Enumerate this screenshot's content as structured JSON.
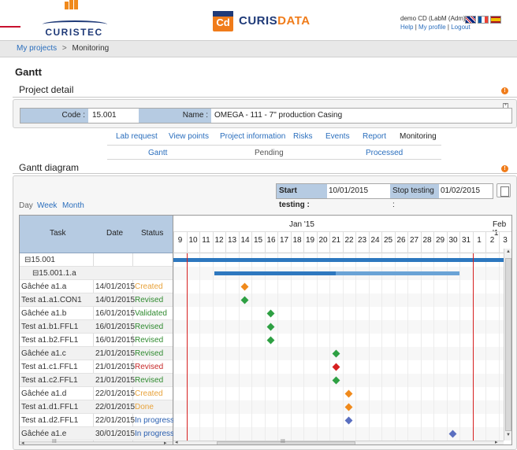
{
  "header": {
    "logo_left": "CURISTEC",
    "logo_center_mark": "Cd",
    "brand_a": "CURIS",
    "brand_b": "DATA",
    "user": "demo CD (LabM (Adm))",
    "help": "Help",
    "profile": "My profile",
    "logout": "Logout",
    "sep": "|",
    "flags": [
      "uk-flag",
      "fr-flag",
      "es-flag"
    ]
  },
  "breadcrumb": {
    "link": "My projects",
    "sep": ">",
    "current": "Monitoring"
  },
  "page_title": "Gantt",
  "project_detail": {
    "title": "Project detail",
    "code_label": "Code :",
    "code_value": "15.001",
    "name_label": "Name :",
    "name_value": "OMEGA - 111 - 7\" production Casing"
  },
  "menu": [
    "Lab request",
    "View points",
    "Project information",
    "Risks",
    "Events",
    "Report",
    "Monitoring"
  ],
  "submenu": [
    "Gantt",
    "Pending",
    "Processed"
  ],
  "gantt": {
    "title": "Gantt diagram",
    "start_label": "Start testing :",
    "start_value": "10/01/2015",
    "stop_label": "Stop testing :",
    "stop_value": "01/02/2015",
    "scales": [
      "Day",
      "Week",
      "Month"
    ],
    "columns": [
      "Task",
      "Date",
      "Status"
    ],
    "months": [
      "Jan '15",
      "Feb '1"
    ],
    "days": [
      "9",
      "10",
      "11",
      "12",
      "13",
      "14",
      "15",
      "16",
      "17",
      "18",
      "19",
      "20",
      "21",
      "22",
      "23",
      "24",
      "25",
      "26",
      "27",
      "28",
      "29",
      "30",
      "31",
      "1",
      "2",
      "3"
    ],
    "scroll_label": "III",
    "rows": [
      {
        "task": "⊟15.001",
        "date": "",
        "status": ""
      },
      {
        "task": "⊟15.001.1.a",
        "date": "",
        "status": ""
      },
      {
        "task": "Gâchée a1.a",
        "date": "14/01/2015",
        "status": "Created"
      },
      {
        "task": "Test a1.a1.CON1",
        "date": "14/01/2015",
        "status": "Revised"
      },
      {
        "task": "Gâchée a1.b",
        "date": "16/01/2015",
        "status": "Validated"
      },
      {
        "task": "Test a1.b1.FFL1",
        "date": "16/01/2015",
        "status": "Revised"
      },
      {
        "task": "Test a1.b2.FFL1",
        "date": "16/01/2015",
        "status": "Revised"
      },
      {
        "task": "Gâchée a1.c",
        "date": "21/01/2015",
        "status": "Revised"
      },
      {
        "task": "Test a1.c1.FFL1",
        "date": "21/01/2015",
        "status": "Revised"
      },
      {
        "task": "Test a1.c2.FFL1",
        "date": "21/01/2015",
        "status": "Revised"
      },
      {
        "task": "Gâchée a1.d",
        "date": "22/01/2015",
        "status": "Created"
      },
      {
        "task": "Test a1.d1.FFL1",
        "date": "22/01/2015",
        "status": "Done"
      },
      {
        "task": "Test a1.d2.FFL1",
        "date": "22/01/2015",
        "status": "In progress"
      },
      {
        "task": "Gâchée a1.e",
        "date": "30/01/2015",
        "status": "In progress"
      }
    ],
    "milestones": [
      {
        "row": 2,
        "day": "14",
        "color": "#f08a1c"
      },
      {
        "row": 3,
        "day": "14",
        "color": "#2ea043"
      },
      {
        "row": 4,
        "day": "16",
        "color": "#2ea043"
      },
      {
        "row": 5,
        "day": "16",
        "color": "#2ea043"
      },
      {
        "row": 6,
        "day": "16",
        "color": "#2ea043"
      },
      {
        "row": 7,
        "day": "21",
        "color": "#2ea043"
      },
      {
        "row": 8,
        "day": "21",
        "color": "#d62020"
      },
      {
        "row": 9,
        "day": "21",
        "color": "#2ea043"
      },
      {
        "row": 10,
        "day": "22",
        "color": "#f08a1c"
      },
      {
        "row": 11,
        "day": "22",
        "color": "#f08a1c"
      },
      {
        "row": 12,
        "day": "22",
        "color": "#5a6fc0"
      },
      {
        "row": 13,
        "day": "30",
        "color": "#5a6fc0"
      }
    ]
  },
  "colors": {
    "accent": "#f07c1a",
    "brand_blue": "#1f3a78",
    "link": "#2a6ebd",
    "header_blue": "#b6cbe2",
    "bar_blue": "#2d78bf"
  }
}
